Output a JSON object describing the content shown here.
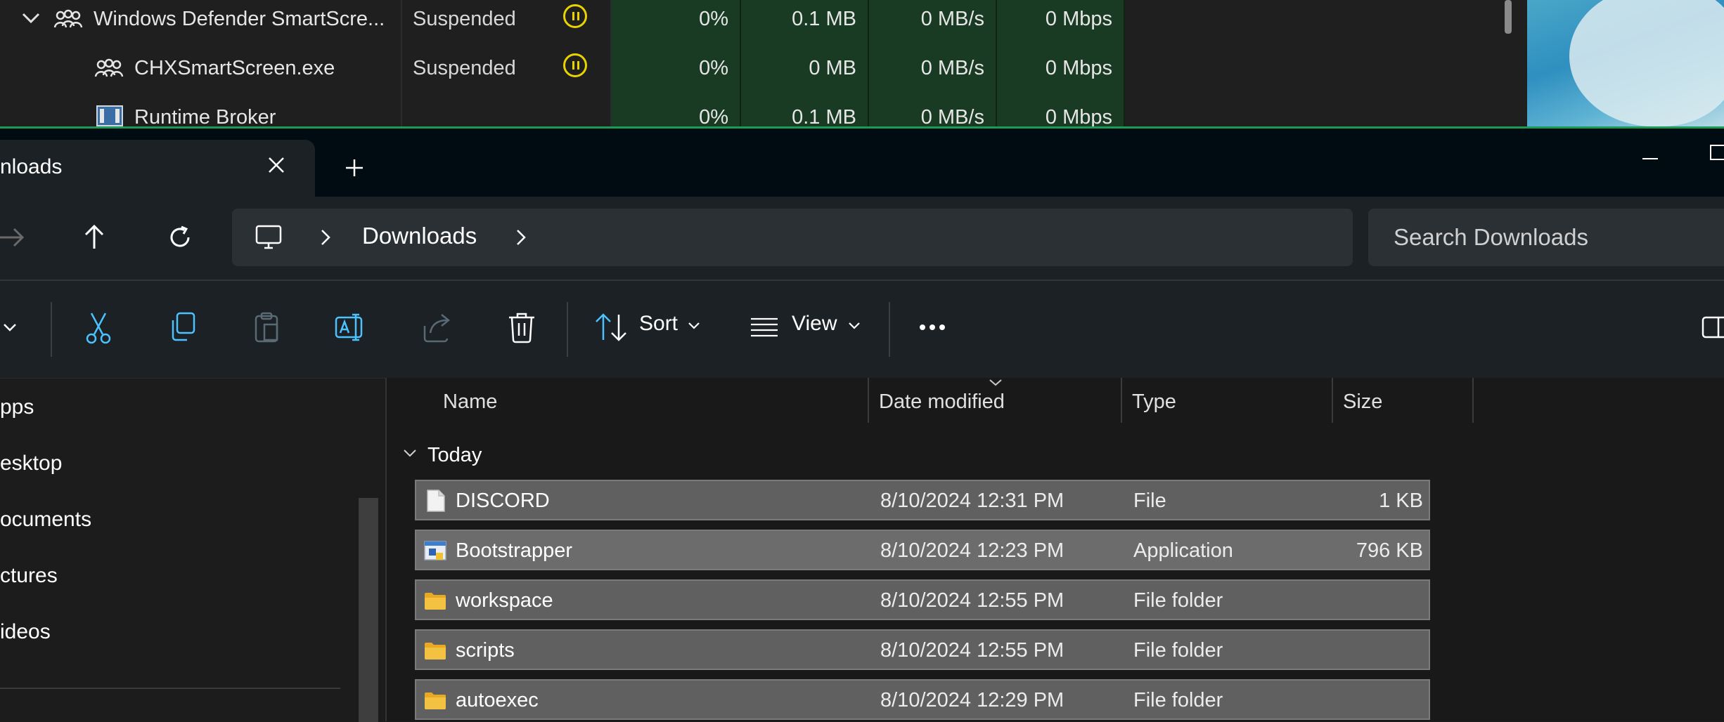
{
  "task_manager": {
    "rows": [
      {
        "name": "Windows Defender SmartScre...",
        "status": "Suspended",
        "cpu": "0%",
        "memory": "0.1 MB",
        "disk": "0 MB/s",
        "network": "0 Mbps",
        "expanded": true,
        "icon": "process-group-icon"
      },
      {
        "name": "CHXSmartScreen.exe",
        "status": "Suspended",
        "cpu": "0%",
        "memory": "0 MB",
        "disk": "0 MB/s",
        "network": "0 Mbps",
        "icon": "process-group-icon"
      },
      {
        "name": "Runtime Broker",
        "status": "",
        "cpu": "0%",
        "memory": "0.1 MB",
        "disk": "0 MB/s",
        "network": "0 Mbps",
        "icon": "window-app-icon"
      }
    ],
    "highlight_color": "#193a23",
    "status_icon_color": "#e8d300"
  },
  "explorer": {
    "tab_title": "nloads",
    "search_placeholder": "Search Downloads",
    "breadcrumb": [
      "Downloads"
    ],
    "toolbar": {
      "sort_label": "Sort",
      "view_label": "View"
    },
    "nav_items": [
      "pps",
      "esktop",
      "ocuments",
      "ctures",
      "ideos"
    ],
    "columns": {
      "name": "Name",
      "date": "Date modified",
      "type": "Type",
      "size": "Size"
    },
    "group_label": "Today",
    "files": [
      {
        "name": "DISCORD",
        "date": "8/10/2024 12:31 PM",
        "type": "File",
        "size": "1 KB",
        "icon": "file-icon"
      },
      {
        "name": "Bootstrapper",
        "date": "8/10/2024 12:23 PM",
        "type": "Application",
        "size": "796 KB",
        "icon": "application-icon"
      },
      {
        "name": "workspace",
        "date": "8/10/2024 12:55 PM",
        "type": "File folder",
        "size": "",
        "icon": "folder-icon"
      },
      {
        "name": "scripts",
        "date": "8/10/2024 12:55 PM",
        "type": "File folder",
        "size": "",
        "icon": "folder-icon"
      },
      {
        "name": "autoexec",
        "date": "8/10/2024 12:29 PM",
        "type": "File folder",
        "size": "",
        "icon": "folder-icon"
      }
    ],
    "accent_color": "#4cc2ff",
    "folder_color": "#f4c243"
  }
}
